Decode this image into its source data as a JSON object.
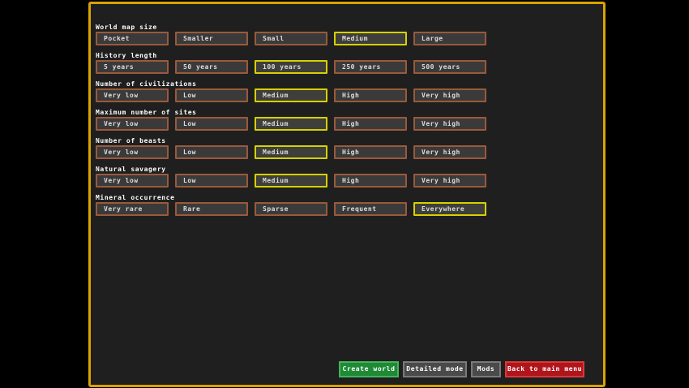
{
  "groups": [
    {
      "label": "World map size",
      "options": [
        "Pocket",
        "Smaller",
        "Small",
        "Medium",
        "Large"
      ],
      "selected": 3
    },
    {
      "label": "History length",
      "options": [
        "5 years",
        "50 years",
        "100 years",
        "250 years",
        "500 years"
      ],
      "selected": 2
    },
    {
      "label": "Number of civilizations",
      "options": [
        "Very low",
        "Low",
        "Medium",
        "High",
        "Very high"
      ],
      "selected": 2
    },
    {
      "label": "Maximum number of sites",
      "options": [
        "Very low",
        "Low",
        "Medium",
        "High",
        "Very high"
      ],
      "selected": 2
    },
    {
      "label": "Number of beasts",
      "options": [
        "Very low",
        "Low",
        "Medium",
        "High",
        "Very high"
      ],
      "selected": 2
    },
    {
      "label": "Natural savagery",
      "options": [
        "Very low",
        "Low",
        "Medium",
        "High",
        "Very high"
      ],
      "selected": 2
    },
    {
      "label": "Mineral occurrence",
      "options": [
        "Very rare",
        "Rare",
        "Sparse",
        "Frequent",
        "Everywhere"
      ],
      "selected": 4
    }
  ],
  "buttons": {
    "create": "Create world",
    "detailed": "Detailed mode",
    "mods": "Mods",
    "back": "Back to main menu"
  },
  "colors": {
    "panel_border": "#d9a300",
    "selected_border": "#d6d100",
    "option_border": "#9a5a3a",
    "create_button": "#1e8a35",
    "back_button": "#b0151c"
  }
}
